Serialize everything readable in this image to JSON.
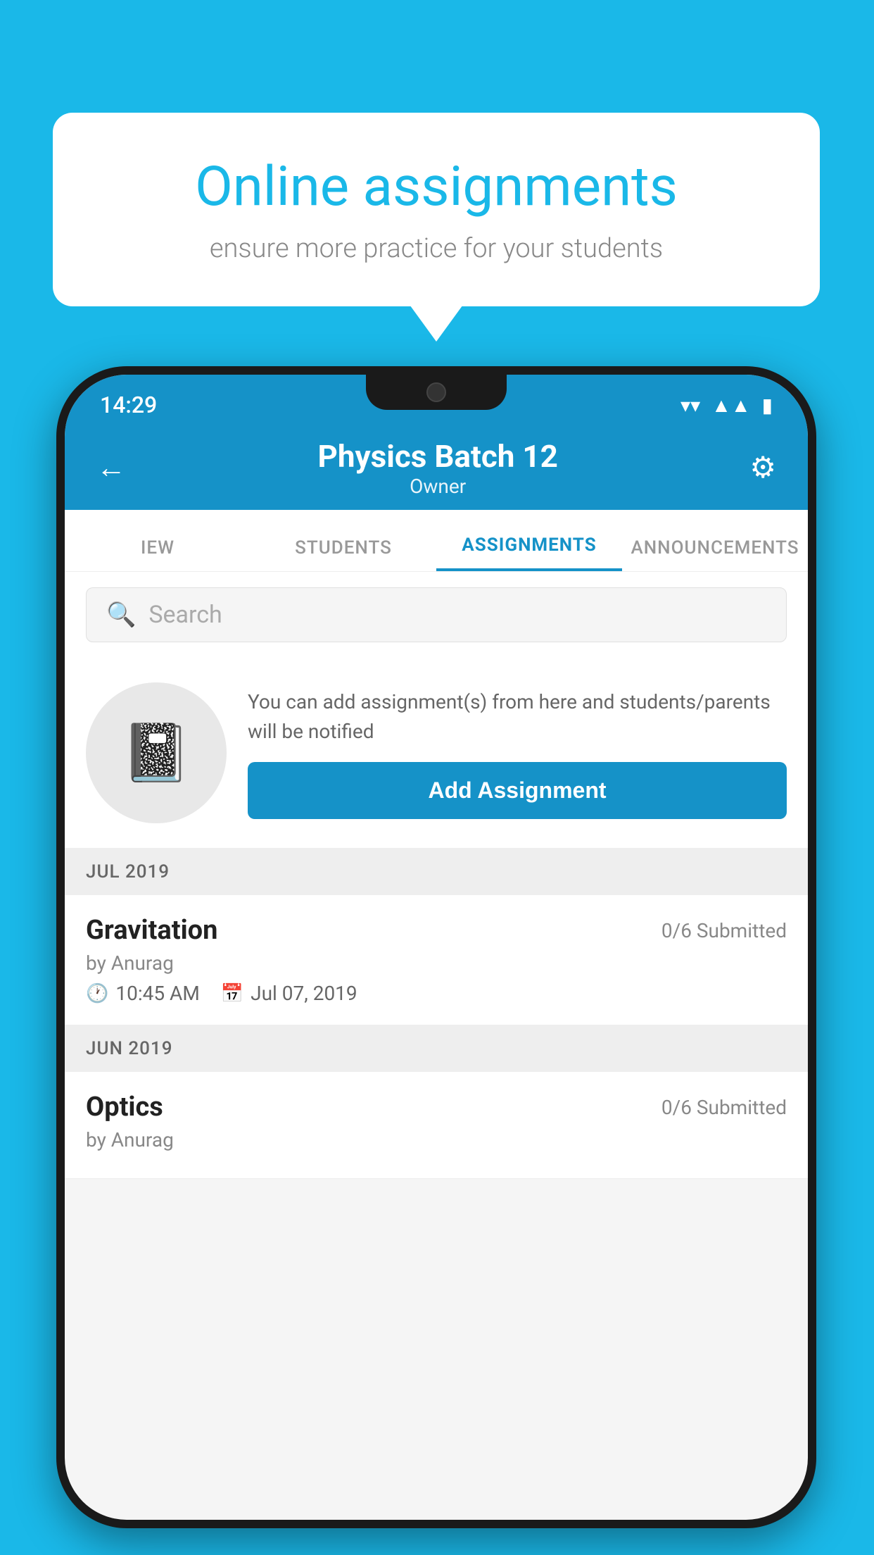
{
  "background_color": "#1ab8e8",
  "speech_bubble": {
    "title": "Online assignments",
    "subtitle": "ensure more practice for your students"
  },
  "phone": {
    "status_bar": {
      "time": "14:29",
      "icons": [
        "wifi",
        "signal",
        "battery"
      ]
    },
    "header": {
      "title": "Physics Batch 12",
      "subtitle": "Owner",
      "back_label": "←",
      "settings_label": "⚙"
    },
    "tabs": [
      {
        "label": "IEW",
        "active": false
      },
      {
        "label": "STUDENTS",
        "active": false
      },
      {
        "label": "ASSIGNMENTS",
        "active": true
      },
      {
        "label": "ANNOUNCEMENTS",
        "active": false
      }
    ],
    "search": {
      "placeholder": "Search"
    },
    "promo": {
      "text": "You can add assignment(s) from here and students/parents will be notified",
      "button_label": "Add Assignment"
    },
    "sections": [
      {
        "header": "JUL 2019",
        "assignments": [
          {
            "title": "Gravitation",
            "submitted": "0/6 Submitted",
            "by": "by Anurag",
            "time": "10:45 AM",
            "date": "Jul 07, 2019"
          }
        ]
      },
      {
        "header": "JUN 2019",
        "assignments": [
          {
            "title": "Optics",
            "submitted": "0/6 Submitted",
            "by": "by Anurag",
            "time": "",
            "date": ""
          }
        ]
      }
    ]
  }
}
